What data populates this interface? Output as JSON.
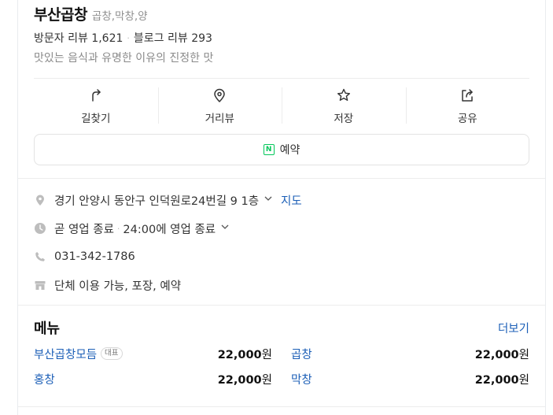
{
  "place": {
    "name": "부산곱창",
    "category": "곱창,막창,양",
    "visitor_reviews": "방문자 리뷰 1,621",
    "blog_reviews": "블로그 리뷰 293",
    "description": "맛있는 음식과 유명한 이유의 진정한 맛"
  },
  "actions": [
    {
      "label": "길찾기",
      "icon": "directions-icon"
    },
    {
      "label": "거리뷰",
      "icon": "map-pin-icon"
    },
    {
      "label": "저장",
      "icon": "star-icon"
    },
    {
      "label": "공유",
      "icon": "share-icon"
    }
  ],
  "reserve": {
    "badge": "N",
    "label": "예약",
    "badge_color": "#03c75a"
  },
  "info": {
    "address": "경기 안양시 동안구 인덕원로24번길 9 1층",
    "map_link": "지도",
    "hours_status": "곧 영업 종료",
    "hours_detail": "24:00에 영업 종료",
    "phone": "031-342-1786",
    "amenities": "단체 이용 가능, 포장, 예약"
  },
  "menu": {
    "title": "메뉴",
    "more_label": "더보기",
    "items": [
      {
        "name": "부산곱창모듬",
        "tag": "대표",
        "price": "22,000",
        "unit": "원"
      },
      {
        "name": "곱창",
        "tag": "",
        "price": "22,000",
        "unit": "원"
      },
      {
        "name": "홍창",
        "tag": "",
        "price": "22,000",
        "unit": "원"
      },
      {
        "name": "막창",
        "tag": "",
        "price": "22,000",
        "unit": "원"
      }
    ]
  },
  "colors": {
    "link": "#1c5fb7",
    "accent_green": "#03c75a",
    "muted": "#8a8a8a"
  }
}
